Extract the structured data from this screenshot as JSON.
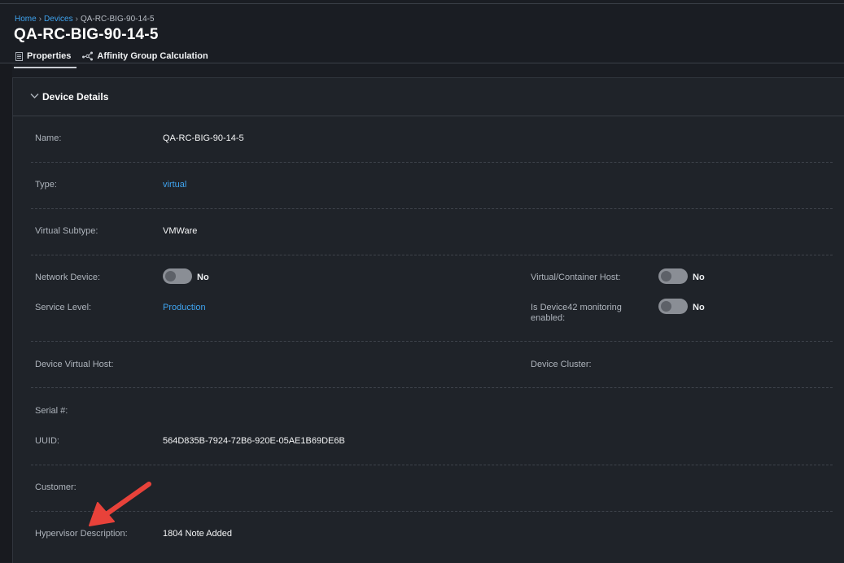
{
  "breadcrumb": {
    "home": "Home",
    "sep": "›",
    "devices": "Devices",
    "current": "QA-RC-BIG-90-14-5"
  },
  "page_title": "QA-RC-BIG-90-14-5",
  "tabs": [
    {
      "label": "Properties",
      "icon": "document-icon",
      "active": true
    },
    {
      "label": "Affinity Group Calculation",
      "icon": "network-nodes-icon",
      "active": false
    }
  ],
  "panel": {
    "title": "Device Details",
    "collapse_icon": "chevron-down-icon"
  },
  "fields": {
    "name": {
      "label": "Name:",
      "value": "QA-RC-BIG-90-14-5"
    },
    "type": {
      "label": "Type:",
      "value": "virtual"
    },
    "virtual_subtype": {
      "label": "Virtual Subtype:",
      "value": "VMWare"
    },
    "network_device": {
      "label": "Network Device:",
      "value": "No"
    },
    "container_host": {
      "label": "Virtual/Container Host:",
      "value": "No"
    },
    "service_level": {
      "label": "Service Level:",
      "value": "Production"
    },
    "monitoring": {
      "label_line1": "Is Device42 monitoring",
      "label_line2": "enabled:",
      "value": "No"
    },
    "virtual_host": {
      "label": "Device Virtual Host:",
      "value": ""
    },
    "cluster": {
      "label": "Device Cluster:",
      "value": ""
    },
    "serial": {
      "label": "Serial #:",
      "value": ""
    },
    "uuid": {
      "label": "UUID:",
      "value": "564D835B-7924-72B6-920E-05AE1B69DE6B"
    },
    "customer": {
      "label": "Customer:",
      "value": ""
    },
    "hypervisor": {
      "label": "Hypervisor Description:",
      "value": "1804 Note Added"
    }
  },
  "colors": {
    "link": "#3fa4f0",
    "annotation_arrow": "#e8423a",
    "background": "#1a1d23",
    "panel": "#1f2329"
  }
}
